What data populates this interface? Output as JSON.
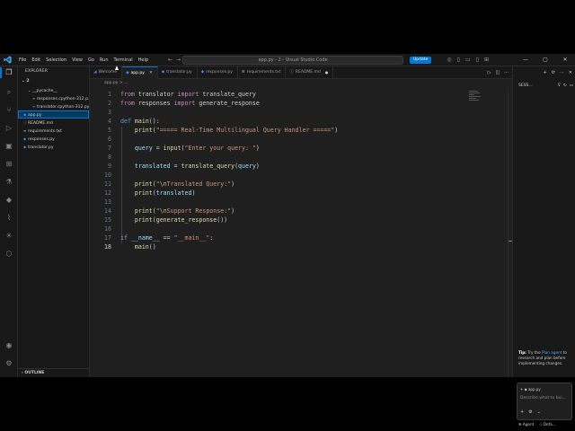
{
  "titlebar": {
    "menu": [
      "File",
      "Edit",
      "Selection",
      "View",
      "Go",
      "Run",
      "Terminal",
      "Help"
    ],
    "nav_back": "←",
    "nav_forward": "→",
    "command_center": "app.py - 2 - Visual Studio Code",
    "update_label": "Update"
  },
  "sidebar": {
    "title": "EXPLORER",
    "more": "···",
    "folder": "2",
    "tree": [
      {
        "label": "__pycache__",
        "indent": 1,
        "icon": "chevron-down",
        "selected": false
      },
      {
        "label": "responses.cpython-312.p...",
        "indent": 2,
        "icon": "py-cache",
        "selected": false
      },
      {
        "label": "translator.cpython-312.pyc",
        "indent": 2,
        "icon": "py-cache",
        "selected": false
      },
      {
        "label": "app.py",
        "indent": 0,
        "icon": "python",
        "selected": true
      },
      {
        "label": "README.md",
        "indent": 0,
        "icon": "info",
        "selected": false
      },
      {
        "label": "requirements.txt",
        "indent": 0,
        "icon": "text",
        "selected": false
      },
      {
        "label": "responses.py",
        "indent": 0,
        "icon": "python",
        "selected": false
      },
      {
        "label": "translator.py",
        "indent": 0,
        "icon": "python",
        "selected": false
      }
    ],
    "outline_label": "OUTLINE"
  },
  "tabs": [
    {
      "label": "Welcome",
      "icon": "vscode",
      "active": false,
      "state": ""
    },
    {
      "label": "app.py",
      "icon": "python",
      "active": true,
      "state": "close"
    },
    {
      "label": "translator.py",
      "icon": "python",
      "active": false,
      "state": ""
    },
    {
      "label": "responses.py",
      "icon": "python",
      "active": false,
      "state": ""
    },
    {
      "label": "requirements.txt",
      "icon": "text",
      "active": false,
      "state": ""
    },
    {
      "label": "README.md",
      "icon": "info",
      "active": false,
      "state": "dot"
    }
  ],
  "breadcrumb": "app.py > ...",
  "editor": {
    "current_line": 18,
    "lines": [
      {
        "n": 1,
        "tokens": [
          [
            "kw2",
            "from"
          ],
          [
            "",
            "·translator·"
          ],
          [
            "kw2",
            "import"
          ],
          [
            "",
            "·translate_query"
          ]
        ]
      },
      {
        "n": 2,
        "tokens": [
          [
            "kw2",
            "from"
          ],
          [
            "",
            "·responses·"
          ],
          [
            "kw2",
            "import"
          ],
          [
            "",
            "·generate_response"
          ]
        ]
      },
      {
        "n": 3,
        "tokens": []
      },
      {
        "n": 4,
        "tokens": [
          [
            "kw",
            "def"
          ],
          [
            "",
            "·"
          ],
          [
            "fn",
            "main"
          ],
          [
            "",
            "():"
          ]
        ]
      },
      {
        "n": 5,
        "tokens": [
          [
            "",
            "····"
          ],
          [
            "fn",
            "print"
          ],
          [
            "",
            "("
          ],
          [
            "str",
            "\"===== Real-Time Multilingual Query Handler =====\""
          ],
          [
            "",
            ")"
          ]
        ]
      },
      {
        "n": 6,
        "tokens": []
      },
      {
        "n": 7,
        "tokens": [
          [
            "",
            "····"
          ],
          [
            "var",
            "query"
          ],
          [
            "",
            "·=·"
          ],
          [
            "fn",
            "input"
          ],
          [
            "",
            "("
          ],
          [
            "str",
            "\"Enter your query: \""
          ],
          [
            "",
            ")"
          ]
        ]
      },
      {
        "n": 8,
        "tokens": []
      },
      {
        "n": 9,
        "tokens": [
          [
            "",
            "····"
          ],
          [
            "var",
            "translated"
          ],
          [
            "",
            "·=·"
          ],
          [
            "fn",
            "translate_query"
          ],
          [
            "",
            "("
          ],
          [
            "var",
            "query"
          ],
          [
            "",
            ")"
          ]
        ]
      },
      {
        "n": 10,
        "tokens": []
      },
      {
        "n": 11,
        "tokens": [
          [
            "",
            "····"
          ],
          [
            "fn",
            "print"
          ],
          [
            "",
            "("
          ],
          [
            "str",
            "\""
          ],
          [
            "esc",
            "\\n"
          ],
          [
            "str",
            "Translated Query:\""
          ],
          [
            "",
            ")"
          ]
        ]
      },
      {
        "n": 12,
        "tokens": [
          [
            "",
            "····"
          ],
          [
            "fn",
            "print"
          ],
          [
            "",
            "("
          ],
          [
            "var",
            "translated"
          ],
          [
            "",
            ")"
          ]
        ]
      },
      {
        "n": 13,
        "tokens": []
      },
      {
        "n": 14,
        "tokens": [
          [
            "",
            "····"
          ],
          [
            "fn",
            "print"
          ],
          [
            "",
            "("
          ],
          [
            "str",
            "\""
          ],
          [
            "esc",
            "\\n"
          ],
          [
            "str",
            "Support Response:\""
          ],
          [
            "",
            ")"
          ]
        ]
      },
      {
        "n": 15,
        "tokens": [
          [
            "",
            "····"
          ],
          [
            "fn",
            "print"
          ],
          [
            "",
            "("
          ],
          [
            "fn",
            "generate_response"
          ],
          [
            "",
            "())"
          ]
        ]
      },
      {
        "n": 16,
        "tokens": []
      },
      {
        "n": 17,
        "tokens": [
          [
            "kw2",
            "if"
          ],
          [
            "",
            "·"
          ],
          [
            "var",
            "__name__"
          ],
          [
            "",
            "·==·"
          ],
          [
            "str",
            "\"__main__\""
          ],
          [
            "",
            ":"
          ]
        ]
      },
      {
        "n": 18,
        "tokens": [
          [
            "",
            "····"
          ],
          [
            "fn",
            "main"
          ],
          [
            "",
            "()"
          ]
        ]
      }
    ]
  },
  "chat": {
    "title": "SESS...",
    "tip_prefix": "Tip:",
    "tip_text_1": "Try the",
    "tip_link": "Plan agent",
    "tip_text_2": "to research and plan before implementing changes.",
    "context_chip": "app.py",
    "placeholder": "Describe what to bui...",
    "agent_label": "Agent",
    "model_label": "Defa..."
  },
  "colors": {
    "accent": "#0078d4",
    "editor_bg": "#1f1f1f",
    "panel_bg": "#181818"
  }
}
